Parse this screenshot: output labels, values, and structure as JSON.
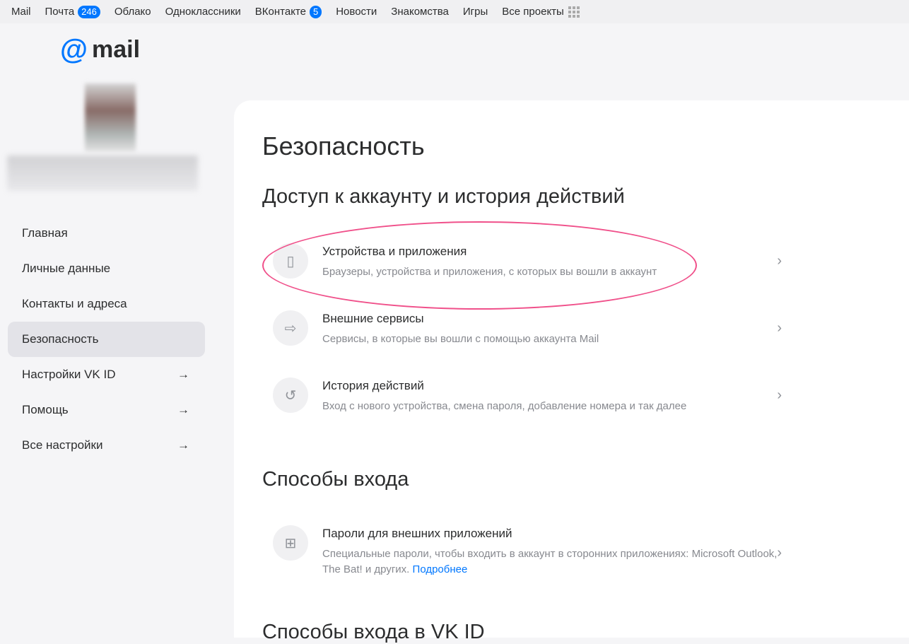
{
  "topbar": {
    "items": [
      {
        "label": "Mail"
      },
      {
        "label": "Почта",
        "badge": "246"
      },
      {
        "label": "Облако"
      },
      {
        "label": "Одноклассники"
      },
      {
        "label": "ВКонтакте",
        "badge": "5"
      },
      {
        "label": "Новости"
      },
      {
        "label": "Знакомства"
      },
      {
        "label": "Игры"
      },
      {
        "label": "Все проекты"
      }
    ]
  },
  "logo": {
    "at": "@",
    "text": "mail"
  },
  "sidebar": {
    "items": [
      {
        "label": "Главная"
      },
      {
        "label": "Личные данные"
      },
      {
        "label": "Контакты и адреса"
      },
      {
        "label": "Безопасность"
      },
      {
        "label": "Настройки VK ID"
      },
      {
        "label": "Помощь"
      },
      {
        "label": "Все настройки"
      }
    ]
  },
  "main": {
    "title": "Безопасность",
    "section1": {
      "title": "Доступ к аккаунту и история действий",
      "rows": [
        {
          "title": "Устройства и приложения",
          "desc": "Браузеры, устройства и приложения, с которых вы вошли в аккаунт"
        },
        {
          "title": "Внешние сервисы",
          "desc": "Сервисы, в которые вы вошли с помощью аккаунта Mail"
        },
        {
          "title": "История действий",
          "desc": "Вход с нового устройства, смена пароля, добавление номера и так далее"
        }
      ]
    },
    "section2": {
      "title": "Способы входа",
      "rows": [
        {
          "title": "Пароли для внешних приложений",
          "desc": "Специальные пароли, чтобы входить в аккаунт в сторонних приложениях: Microsoft Outlook, The Bat! и других.",
          "link": "Подробнее"
        }
      ]
    },
    "section3": {
      "title": "Способы входа в VK ID"
    }
  },
  "colors": {
    "accent": "#0077ff",
    "highlight": "#f0508a"
  }
}
